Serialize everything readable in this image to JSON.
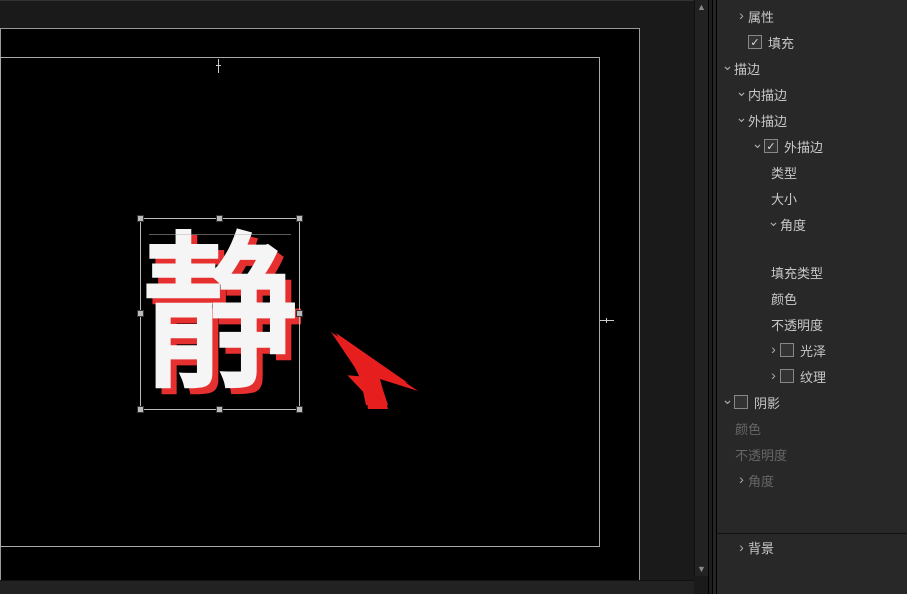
{
  "canvas": {
    "text_content": "静"
  },
  "panel": {
    "title": "属性",
    "fill": {
      "label": "填充",
      "checked": true
    },
    "stroke": {
      "label": "描边",
      "inner": {
        "label": "内描边"
      },
      "outer": {
        "label": "外描边",
        "enabled_label": "外描边",
        "enabled_checked": true,
        "type_label": "类型",
        "size_label": "大小",
        "angle_label": "角度",
        "fill_type_label": "填充类型",
        "color_label": "颜色",
        "opacity_label": "不透明度",
        "gloss": {
          "label": "光泽",
          "checked": false
        },
        "texture": {
          "label": "纹理",
          "checked": false
        }
      }
    },
    "shadow": {
      "label": "阴影",
      "checked": false,
      "color_label": "颜色",
      "opacity_label": "不透明度",
      "angle_label": "角度"
    },
    "background": {
      "label": "背景"
    }
  }
}
